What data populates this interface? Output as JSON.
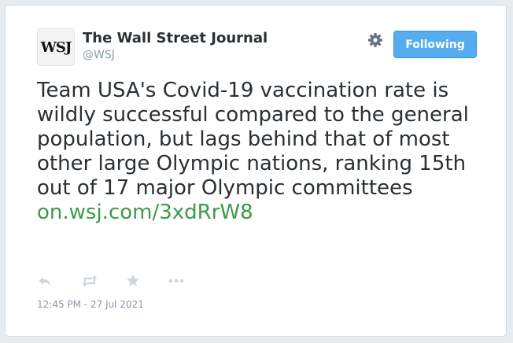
{
  "account": {
    "avatar_text": "WSJ",
    "name": "The Wall Street Journal",
    "handle": "@WSJ"
  },
  "header": {
    "follow_label": "Following"
  },
  "tweet": {
    "text": "Team USA's Covid-19 vaccination rate is wildly successful compared to the general population, but lags behind that of most other large Olympic nations, ranking 15th out of 17 major Olympic committees",
    "link": "on.wsj.com/3xdRrW8",
    "timestamp": "12:45 PM - 27 Jul 2021"
  },
  "icons": {
    "settings": "gear-icon",
    "reply": "reply-icon",
    "retweet": "retweet-icon",
    "favorite": "star-icon",
    "more": "more-icon"
  },
  "colors": {
    "accent": "#55acee",
    "link": "#3b9b47",
    "text": "#292f33",
    "muted": "#8899a6",
    "icon": "#ccd6dd"
  }
}
